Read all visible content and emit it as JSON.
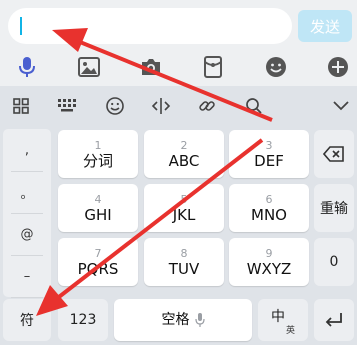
{
  "composer": {
    "input_value": "",
    "send_label": "发送",
    "icons": [
      "microphone-icon",
      "image-icon",
      "camera-icon",
      "red-packet-icon",
      "emoji-icon",
      "plus-icon"
    ]
  },
  "keyboard_toolbar": {
    "icons": [
      "grid-icon",
      "keyboard-icon",
      "emoji-icon",
      "cursor-move-icon",
      "link-icon",
      "search-icon",
      "chevron-down-icon"
    ]
  },
  "keyboard": {
    "side_symbols": [
      ",",
      "。",
      "@",
      "–",
      "!"
    ],
    "keys": [
      {
        "num": "1",
        "label": "分词"
      },
      {
        "num": "2",
        "label": "ABC"
      },
      {
        "num": "3",
        "label": "DEF"
      },
      {
        "num": "4",
        "label": "GHI"
      },
      {
        "num": "5",
        "label": "JKL"
      },
      {
        "num": "6",
        "label": "MNO"
      },
      {
        "num": "7",
        "label": "PQRS"
      },
      {
        "num": "8",
        "label": "TUV"
      },
      {
        "num": "9",
        "label": "WXYZ"
      }
    ],
    "reinput_label": "重输",
    "zero_label": "0",
    "symbols_label": "符",
    "numbers_label": "123",
    "space_label": "空格",
    "lang_main": "中",
    "lang_sub": "英"
  },
  "colors": {
    "accent": "#11b4e6",
    "send_disabled": "#bfe6f6",
    "annotation_arrow": "#e8322e"
  }
}
